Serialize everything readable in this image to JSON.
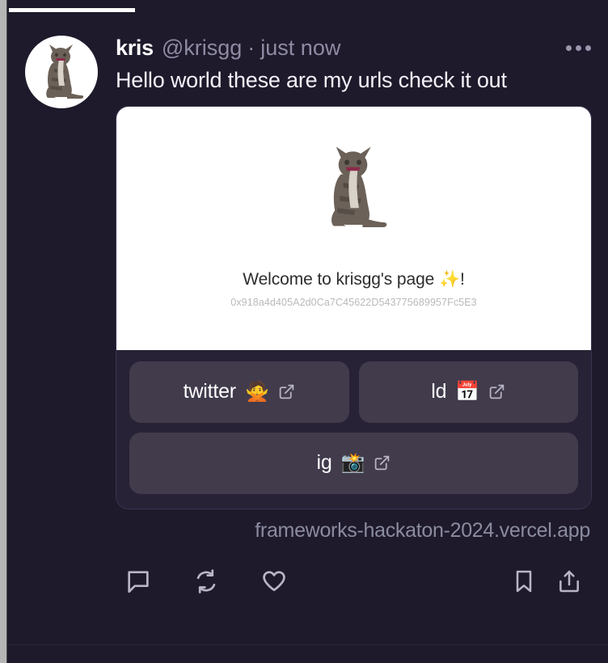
{
  "window": {
    "background_color": "#1e1a2b",
    "progress_percent": 21
  },
  "post": {
    "author": {
      "display_name": "kris",
      "handle": "@krisgg",
      "avatar_icon": "cat-avatar"
    },
    "separator": "·",
    "timestamp": "just now",
    "text": "Hello world these are my urls check it out",
    "more_menu_icon": "ellipsis-icon"
  },
  "link_card": {
    "preview_image_icon": "cat-photo",
    "welcome_heading": "Welcome to krisgg's page ✨!",
    "wallet_address": "0x918a4d405A2d0Ca7C45622D543775689957Fc5E3",
    "links": [
      {
        "label": "twitter",
        "emoji": "🙅",
        "external_icon": "external-link-icon"
      },
      {
        "label": "ld",
        "emoji": "📅",
        "external_icon": "external-link-icon"
      },
      {
        "label": "ig",
        "emoji": "📸",
        "external_icon": "external-link-icon"
      }
    ],
    "url": "frameworks-hackaton-2024.vercel.app"
  },
  "actions": [
    {
      "name": "reply",
      "icon": "comment-icon"
    },
    {
      "name": "repost",
      "icon": "repost-icon"
    },
    {
      "name": "like",
      "icon": "heart-icon"
    },
    {
      "name": "bookmark",
      "icon": "bookmark-icon"
    },
    {
      "name": "share",
      "icon": "share-icon"
    }
  ],
  "colors": {
    "background": "#1e1a2b",
    "card_body": "#272236",
    "link_button": "#413b4c",
    "muted_text": "#8f8ba3",
    "primary_text": "#f3f1f8",
    "accent_white": "#ffffff"
  }
}
